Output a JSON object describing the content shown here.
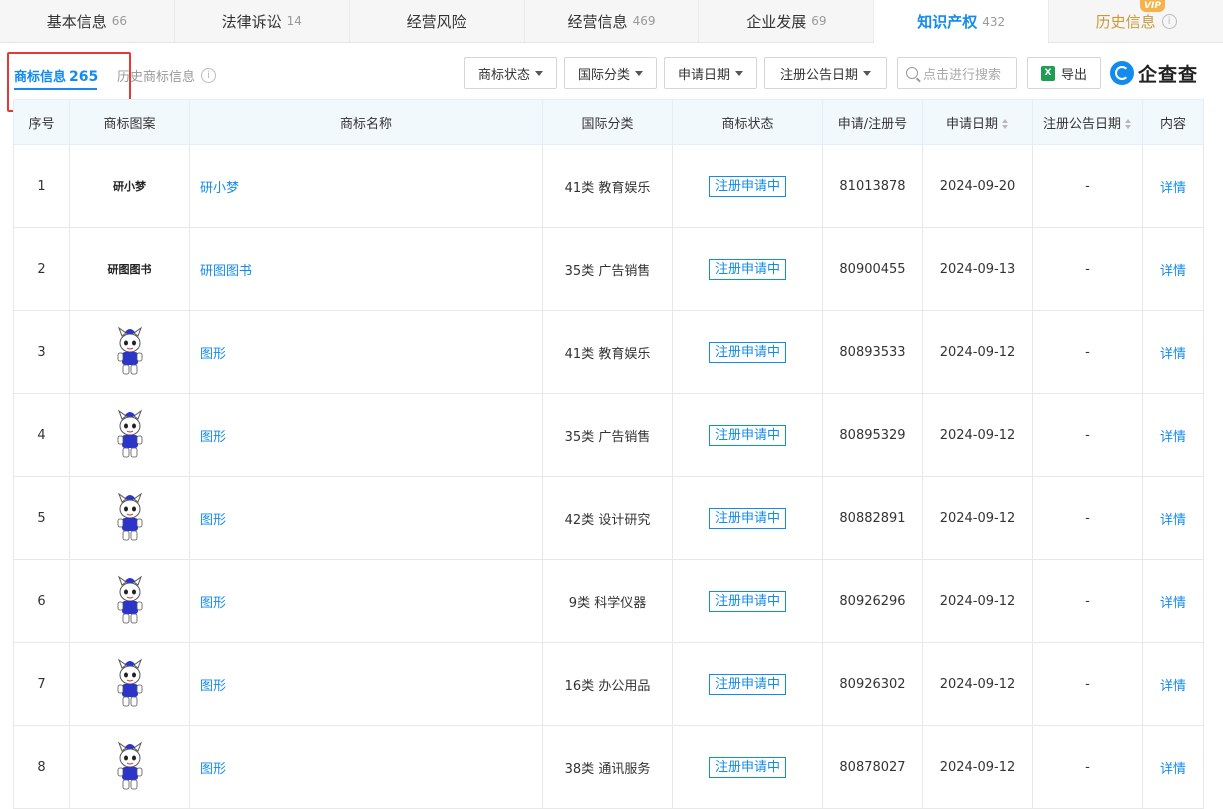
{
  "top_tabs": [
    {
      "label": "基本信息",
      "count": "66"
    },
    {
      "label": "法律诉讼",
      "count": "14"
    },
    {
      "label": "经营风险",
      "count": ""
    },
    {
      "label": "经营信息",
      "count": "469"
    },
    {
      "label": "企业发展",
      "count": "69"
    },
    {
      "label": "知识产权",
      "count": "432"
    },
    {
      "label": "历史信息",
      "count": ""
    }
  ],
  "vip_badge": "VIP",
  "sub_tabs": {
    "current_label": "商标信息",
    "current_count": "265",
    "history_label": "历史商标信息"
  },
  "toolbar": {
    "status_filter": "商标状态",
    "class_filter": "国际分类",
    "apply_date_filter": "申请日期",
    "notice_date_filter": "注册公告日期",
    "search_placeholder": "点击进行搜索",
    "export_label": "导出",
    "logo_text": "企查查"
  },
  "table": {
    "headers": [
      "序号",
      "商标图案",
      "商标名称",
      "国际分类",
      "商标状态",
      "申请/注册号",
      "申请日期",
      "注册公告日期",
      "内容"
    ],
    "rows": [
      {
        "no": "1",
        "image_text": "研小梦",
        "name": "研小梦",
        "class": "41类 教育娱乐",
        "status": "注册申请中",
        "reg_no": "81013878",
        "apply_date": "2024-09-20",
        "notice_date": "-",
        "detail": "详情"
      },
      {
        "no": "2",
        "image_text": "研图图书",
        "name": "研图图书",
        "class": "35类 广告销售",
        "status": "注册申请中",
        "reg_no": "80900455",
        "apply_date": "2024-09-13",
        "notice_date": "-",
        "detail": "详情"
      },
      {
        "no": "3",
        "image_text": "",
        "name": "图形",
        "class": "41类 教育娱乐",
        "status": "注册申请中",
        "reg_no": "80893533",
        "apply_date": "2024-09-12",
        "notice_date": "-",
        "detail": "详情"
      },
      {
        "no": "4",
        "image_text": "",
        "name": "图形",
        "class": "35类 广告销售",
        "status": "注册申请中",
        "reg_no": "80895329",
        "apply_date": "2024-09-12",
        "notice_date": "-",
        "detail": "详情"
      },
      {
        "no": "5",
        "image_text": "",
        "name": "图形",
        "class": "42类 设计研究",
        "status": "注册申请中",
        "reg_no": "80882891",
        "apply_date": "2024-09-12",
        "notice_date": "-",
        "detail": "详情"
      },
      {
        "no": "6",
        "image_text": "",
        "name": "图形",
        "class": "9类 科学仪器",
        "status": "注册申请中",
        "reg_no": "80926296",
        "apply_date": "2024-09-12",
        "notice_date": "-",
        "detail": "详情"
      },
      {
        "no": "7",
        "image_text": "",
        "name": "图形",
        "class": "16类 办公用品",
        "status": "注册申请中",
        "reg_no": "80926302",
        "apply_date": "2024-09-12",
        "notice_date": "-",
        "detail": "详情"
      },
      {
        "no": "8",
        "image_text": "",
        "name": "图形",
        "class": "38类 通讯服务",
        "status": "注册申请中",
        "reg_no": "80878027",
        "apply_date": "2024-09-12",
        "notice_date": "-",
        "detail": "详情"
      }
    ]
  },
  "colors": {
    "accent": "#128bed",
    "header_bg": "#f2f9fc",
    "highlight_box": "#e53935",
    "vip": "#f5b34a"
  }
}
